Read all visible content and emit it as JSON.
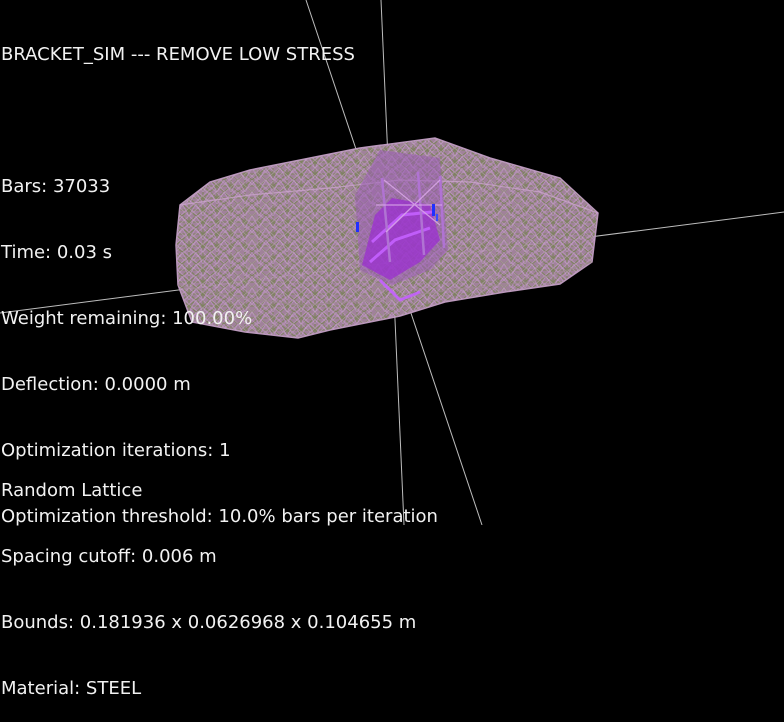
{
  "window": {
    "title": "BRACKET_SIM --- REMOVE LOW STRESS"
  },
  "stats": {
    "bars": "Bars: 37033",
    "time": "Time: 0.03 s",
    "weight_remaining": "Weight remaining: 100.00%",
    "deflection": "Deflection: 0.0000 m",
    "optimization_iterations": "Optimization iterations: 1",
    "optimization_threshold": "Optimization threshold: 10.0% bars per iteration"
  },
  "lattice_info": {
    "type": "Random Lattice",
    "spacing_cutoff": "Spacing cutoff: 0.006 m",
    "bounds": "Bounds: 0.181936 x 0.0626968 x 0.104655 m",
    "material": "Material: STEEL"
  },
  "colors": {
    "background": "#000000",
    "text": "#f2f2f2",
    "axis_line": "#bdbdbd",
    "mesh_base": "#b58fae",
    "mesh_olive": "#8f8c66",
    "mesh_high_stress": "#9b2fd0",
    "support_marker": "#2030ff"
  },
  "scene": {
    "model": "bracket-lattice-mesh",
    "axes": [
      "x-axis",
      "y-axis",
      "z-axis"
    ]
  }
}
